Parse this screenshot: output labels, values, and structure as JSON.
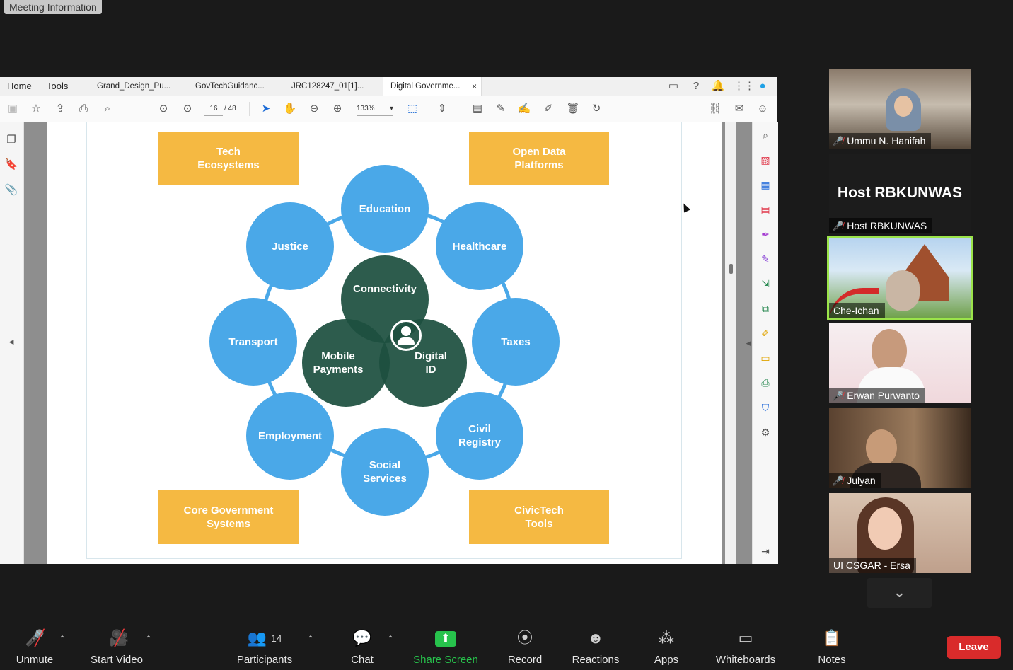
{
  "meeting_info_label": "Meeting Information",
  "pdf": {
    "nav": [
      "Home",
      "Tools"
    ],
    "tabs": [
      {
        "label": "Grand_Design_Pu..."
      },
      {
        "label": "GovTechGuidanc..."
      },
      {
        "label": "JRC128247_01[1]..."
      },
      {
        "label": "Digital Governme..."
      }
    ],
    "close_glyph": "×",
    "page_current": "16",
    "page_total": "/ 48",
    "zoom": "133%"
  },
  "diagram": {
    "corners": [
      "Tech\nEcosystems",
      "Open Data\nPlatforms",
      "Core Government\nSystems",
      "CivicTech\nTools"
    ],
    "outer": [
      "Education",
      "Healthcare",
      "Taxes",
      "Civil\nRegistry",
      "Social\nServices",
      "Employment",
      "Transport",
      "Justice"
    ],
    "inner": [
      "Connectivity",
      "Mobile\nPayments",
      "Digital\nID"
    ]
  },
  "participants_tiles": [
    {
      "name": "Ummu N. Hanifah",
      "muted": true
    },
    {
      "name": "Host RBKUNWAS",
      "muted": true,
      "banner": "Host RBKUNWAS"
    },
    {
      "name": "Che-Ichan",
      "muted": false
    },
    {
      "name": "Erwan Purwanto",
      "muted": true
    },
    {
      "name": "Julyan",
      "muted": true
    },
    {
      "name": "UI CSGAR - Ersa",
      "muted": false
    }
  ],
  "controls": {
    "unmute": "Unmute",
    "start_video": "Start Video",
    "participants": "Participants",
    "participants_count": "14",
    "chat": "Chat",
    "share_screen": "Share Screen",
    "record": "Record",
    "reactions": "Reactions",
    "apps": "Apps",
    "whiteboards": "Whiteboards",
    "notes": "Notes",
    "leave": "Leave"
  },
  "colors": {
    "accent_green": "#27c24c",
    "leave_red": "#d92b2b",
    "box_yellow": "#f5b942",
    "circle_blue": "#4aa8e8",
    "inner_green": "#1d5040"
  }
}
